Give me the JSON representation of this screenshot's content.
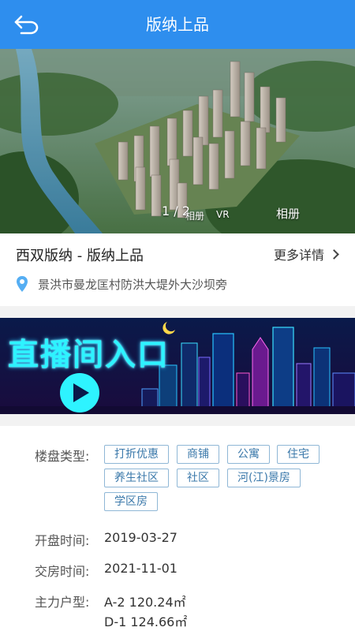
{
  "appbar": {
    "title": "版纳上品",
    "back_icon": "back-arrow-icon"
  },
  "hero": {
    "counter": "1 / 2",
    "tab_album_small": "相册",
    "tab_vr": "VR",
    "tab_album": "相册"
  },
  "info": {
    "project_name": "西双版纳 - 版纳上品",
    "more_details": "更多详情",
    "address": "景洪市曼龙匡村防洪大堤外大沙坝旁"
  },
  "banner": {
    "text": "直播间入口"
  },
  "details": {
    "type_label": "楼盘类型:",
    "tags": [
      "打折优惠",
      "商铺",
      "公寓",
      "住宅",
      "养生社区",
      "社区",
      "河(江)景房",
      "学区房"
    ],
    "open_label": "开盘时间:",
    "open_value": "2019-03-27",
    "delivery_label": "交房时间:",
    "delivery_value": "2021-11-01",
    "unit_label": "主力户型:",
    "units": [
      "A-2 120.24㎡",
      "D-1 124.66㎡"
    ]
  },
  "colors": {
    "accent": "#2e8eee",
    "tag_border": "#8fb7d6",
    "tag_text": "#3a78aa"
  }
}
